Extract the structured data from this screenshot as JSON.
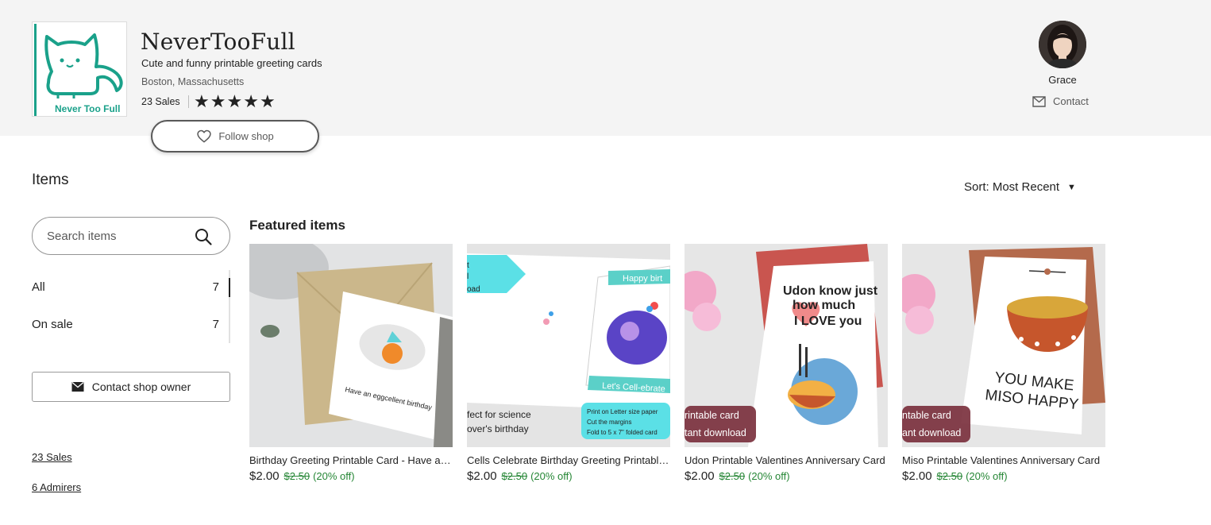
{
  "shop": {
    "name": "NeverTooFull",
    "tagline": "Cute and funny printable greeting cards",
    "location": "Boston, Massachusetts",
    "sales": "23 Sales",
    "rating": 5,
    "logo_text": "Never Too Full",
    "follow_label": "Follow shop"
  },
  "owner": {
    "name": "Grace",
    "contact_label": "Contact"
  },
  "items": {
    "heading": "Items",
    "sort_label": "Sort: Most Recent",
    "search_placeholder": "Search items",
    "sections": [
      {
        "label": "All",
        "count": "7"
      },
      {
        "label": "On sale",
        "count": "7"
      }
    ],
    "contact_owner_label": "Contact shop owner",
    "sales_link": "23 Sales",
    "admirers_link": "6 Admirers"
  },
  "featured": {
    "heading": "Featured items",
    "products": [
      {
        "title": "Birthday Greeting Printable Card - Have an Eggcellent Birthday",
        "price": "$2.00",
        "original_price": "$2.50",
        "discount": "(20% off)",
        "image_text": "Have an eggcellent birthday"
      },
      {
        "title": "Cells Celebrate Birthday Greeting Printable Card",
        "price": "$2.00",
        "original_price": "$2.50",
        "discount": "(20% off)",
        "image_text": {
          "top": "Happy birt",
          "bottom": "Let's Cell-ebrate",
          "left_1": "fect for science",
          "left_2": "over's birthday",
          "arrow_1": "t",
          "arrow_2": "l",
          "arrow_3": "oad",
          "note_1": "Print on Letter size paper",
          "note_2": "Cut the margins",
          "note_3": "Fold to 5 x 7\" folded card"
        }
      },
      {
        "title": "Udon Printable Valentines Anniversary Card",
        "price": "$2.00",
        "original_price": "$2.50",
        "discount": "(20% off)",
        "image_text": {
          "line_1": "Udon know just",
          "line_2": "how much",
          "line_3": "I LOVE you",
          "badge_1": "rintable card",
          "badge_2": "tant download"
        }
      },
      {
        "title": "Miso Printable Valentines Anniversary Card",
        "price": "$2.00",
        "original_price": "$2.50",
        "discount": "(20% off)",
        "image_text": {
          "line_1": "YOU MAKE",
          "line_2": "MISO HAPPY",
          "badge_1": "ntable card",
          "badge_2": "ant download"
        }
      }
    ]
  },
  "colors": {
    "header_bg": "#f4f4f4",
    "logo_teal": "#1aa18a",
    "sale_green": "#258635",
    "badge": "#782c3a"
  },
  "icons": [
    "heart-icon",
    "mail-icon",
    "search-icon",
    "star-icon",
    "caret-down-icon",
    "envelope-icon"
  ]
}
